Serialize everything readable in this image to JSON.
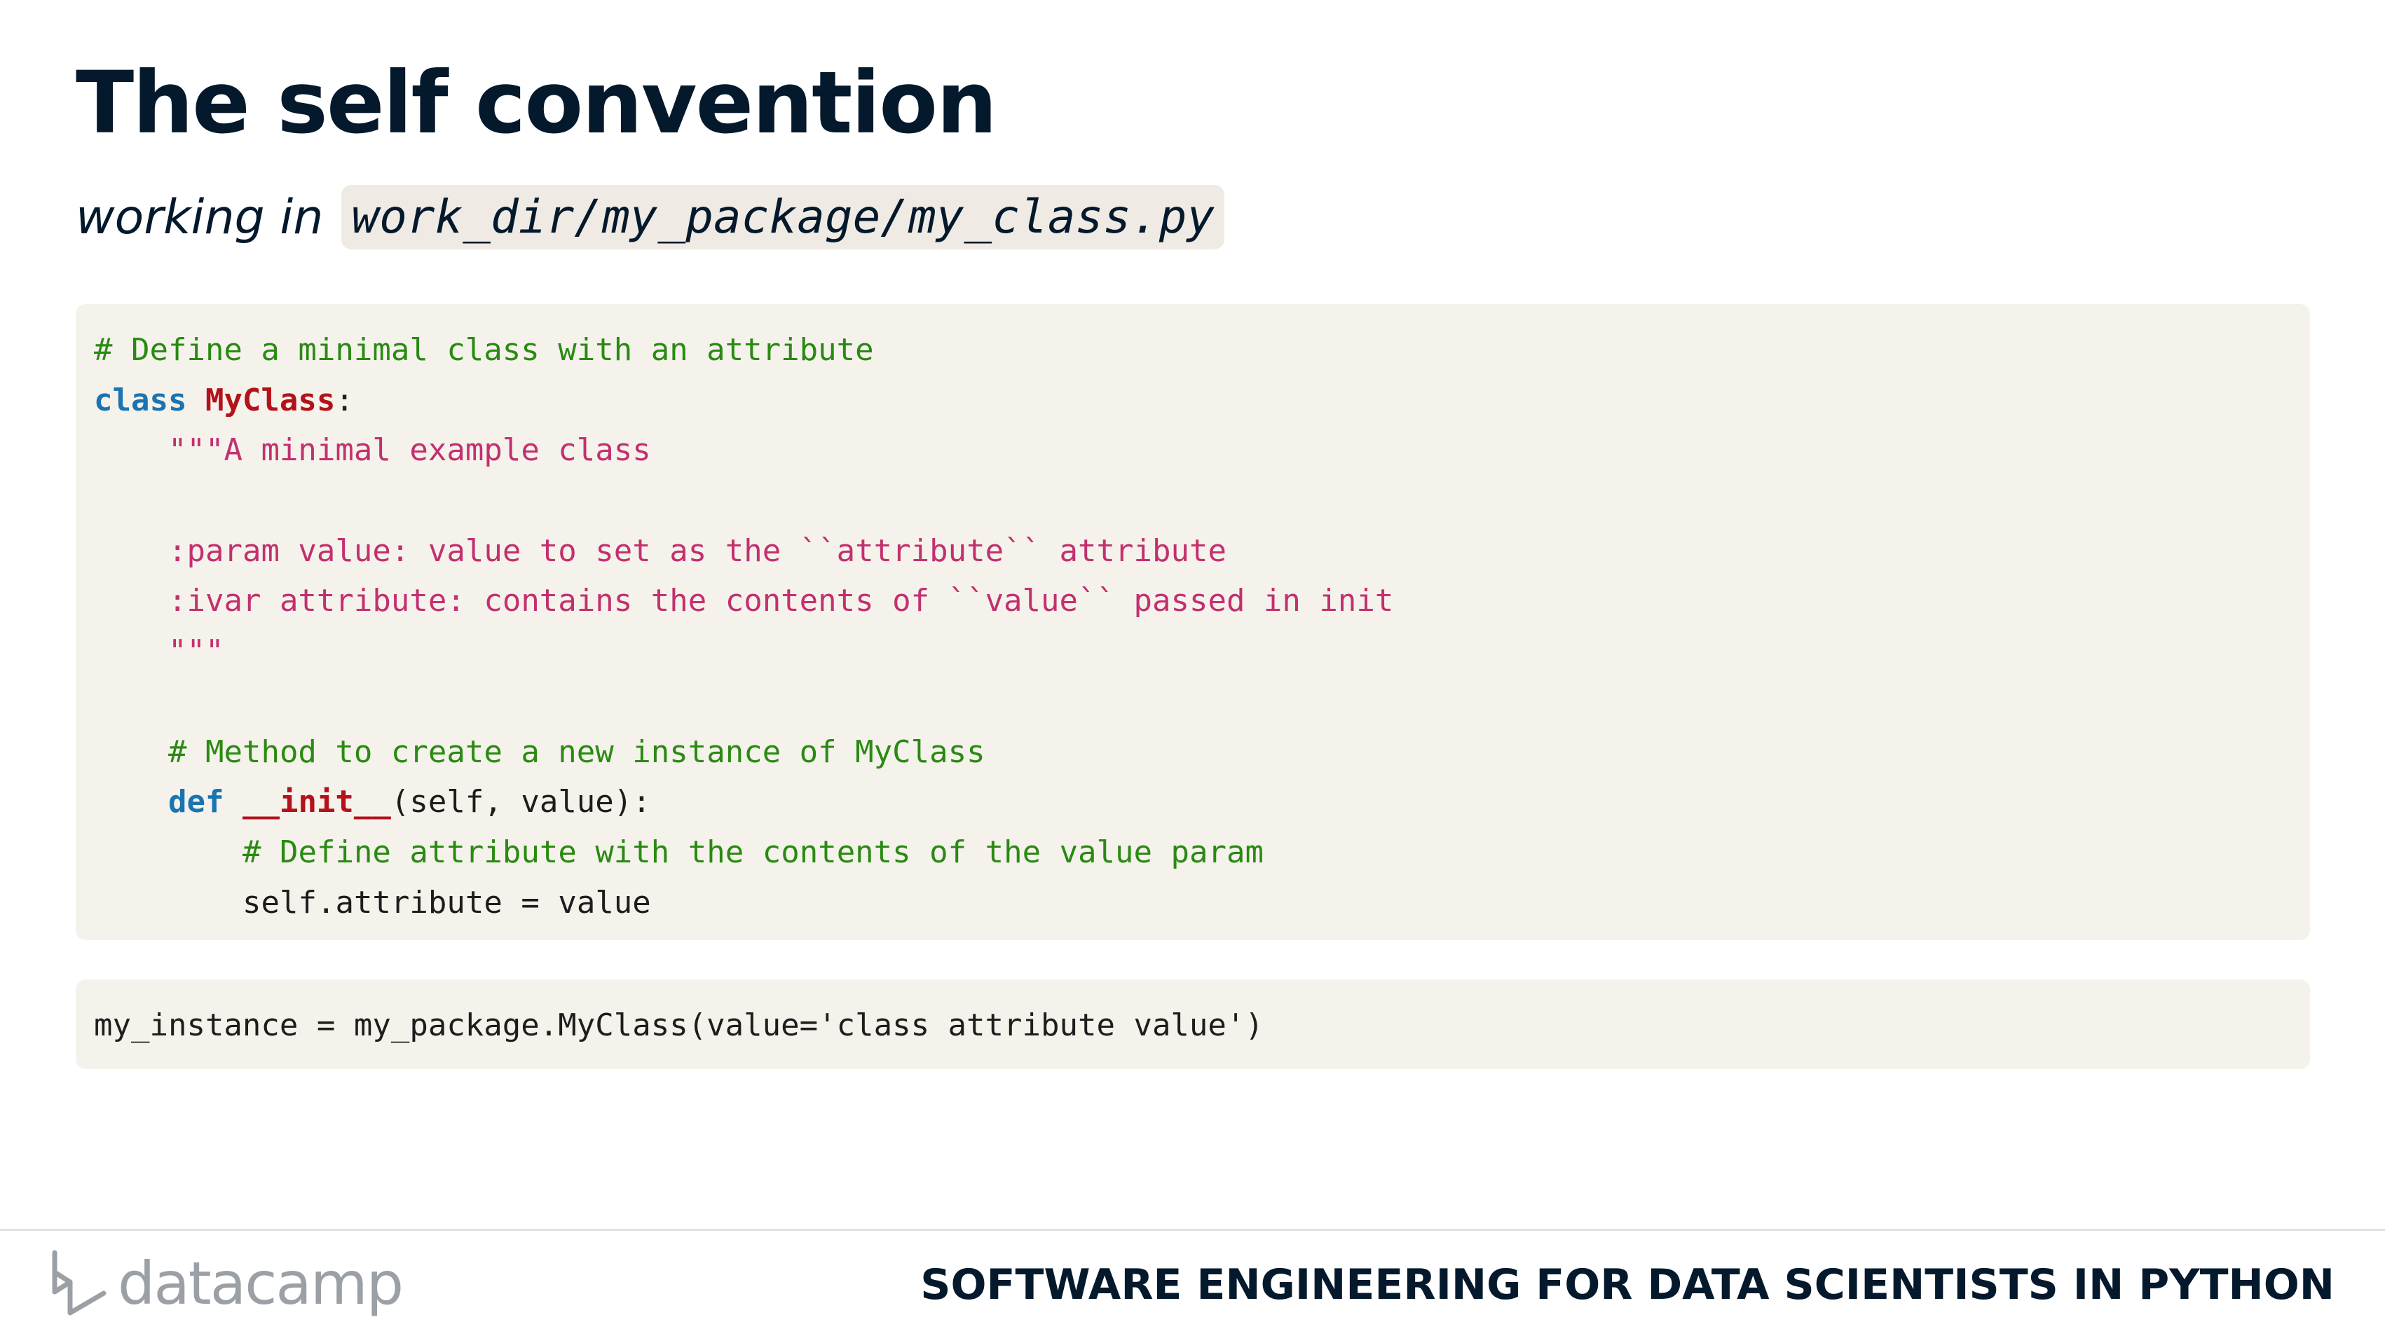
{
  "slide": {
    "title": "The self convention",
    "subtitle_prefix": "working in",
    "subtitle_path": "work_dir/my_package/my_class.py"
  },
  "code_main": {
    "line1": "# Define a minimal class with an attribute",
    "line2_kw": "class",
    "line2_name": "MyClass",
    "line2_rest": ":",
    "line3": "\"\"\"A minimal example class",
    "line4": "",
    "line5": ":param value: value to set as the ``attribute`` attribute",
    "line6": ":ivar attribute: contains the contents of ``value`` passed in init",
    "line7": "\"\"\"",
    "line8": "",
    "line9": "# Method to create a new instance of MyClass",
    "line10_kw": "def",
    "line10_name": "__init__",
    "line10_rest": "(self, value):",
    "line11": "# Define attribute with the contents of the value param",
    "line12": "self.attribute = value"
  },
  "code_usage": {
    "line1": "my_instance = my_package.MyClass(value='class attribute value')"
  },
  "footer": {
    "logo_text": "datacamp",
    "course_title": "SOFTWARE ENGINEERING FOR DATA SCIENTISTS IN PYTHON"
  },
  "colors": {
    "title": "#05192d",
    "code_background": "#f5f2ec",
    "comment": "#2a8a12",
    "docstring": "#c3306e",
    "keyword": "#1a74b0",
    "definition_name": "#b4121a"
  }
}
